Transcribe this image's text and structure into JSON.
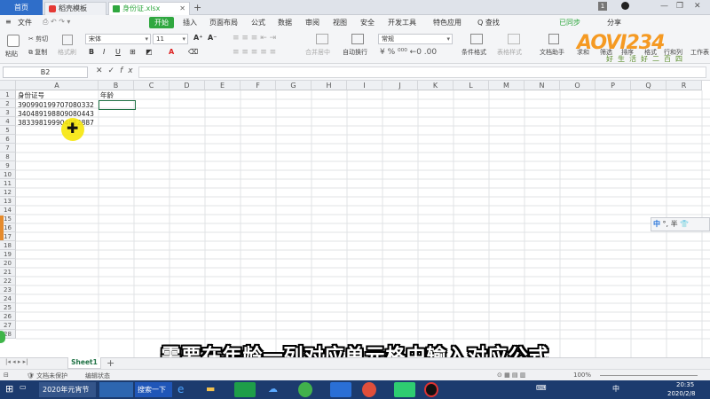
{
  "tabs": {
    "home": "首页",
    "template": "稻壳模板",
    "file": "身份证.xlsx"
  },
  "window": {
    "badge": "1"
  },
  "menu": {
    "file": "文件",
    "start": "开始",
    "insert": "插入",
    "layout": "页面布局",
    "formula": "公式",
    "data": "数据",
    "review": "审阅",
    "view": "视图",
    "security": "安全",
    "developer": "开发工具",
    "special": "特色应用",
    "search": "Q 查找",
    "sync": "已同步",
    "share": "分享"
  },
  "ribbon": {
    "cut": "剪切",
    "copy": "复制",
    "paste": "粘贴",
    "format_painter": "格式刷",
    "font_name": "宋体",
    "font_size": "11",
    "merge": "合并居中",
    "wrap": "自动换行",
    "number_format": "常规",
    "cond_format": "条件格式",
    "table_style": "表格样式",
    "doc_assistant": "文档助手",
    "sum": "求和",
    "filter": "筛选",
    "sort": "排序",
    "fill": "格式",
    "row_col": "行和列",
    "worksheet": "工作表"
  },
  "formula_bar": {
    "name_box": "B2",
    "fx": "fx",
    "value": ""
  },
  "columns": [
    "A",
    "B",
    "C",
    "D",
    "E",
    "F",
    "G",
    "H",
    "I",
    "J",
    "K",
    "L",
    "M",
    "N",
    "O",
    "P",
    "Q",
    "R"
  ],
  "rows": [
    "1",
    "2",
    "3",
    "4",
    "5",
    "6",
    "7",
    "8",
    "9",
    "10",
    "11",
    "12",
    "13",
    "14",
    "15",
    "16",
    "17",
    "18",
    "19",
    "20",
    "21",
    "22",
    "23",
    "24",
    "25",
    "26",
    "27",
    "28"
  ],
  "cells": {
    "a1": "身份证号",
    "b1": "年龄",
    "a2": "390990199707080332",
    "a3": "340489198809080443",
    "a4": "383398199904082887"
  },
  "sheets": {
    "active": "Sheet1",
    "add": "+"
  },
  "status": {
    "protect": "文档未保护",
    "edit_state": "编辑状态",
    "zoom": "100%"
  },
  "taskbar": {
    "window_title": "2020年元宵节",
    "search": "搜索一下",
    "ime": "中",
    "time": "20:35",
    "date": "2020/2/8"
  },
  "ime_bar": {
    "zh": "中",
    "rest": "°, 半"
  },
  "logo": {
    "text": "AOVI234",
    "sub": "好生活好二百四"
  },
  "subtitle": "需要在年龄一列对应单元格中输入对应公式",
  "colors": {
    "accent": "#2fa73f",
    "home_tab": "#2f6ec9",
    "taskbar": "#1c3b6e",
    "cursor": "#f6e70a"
  }
}
